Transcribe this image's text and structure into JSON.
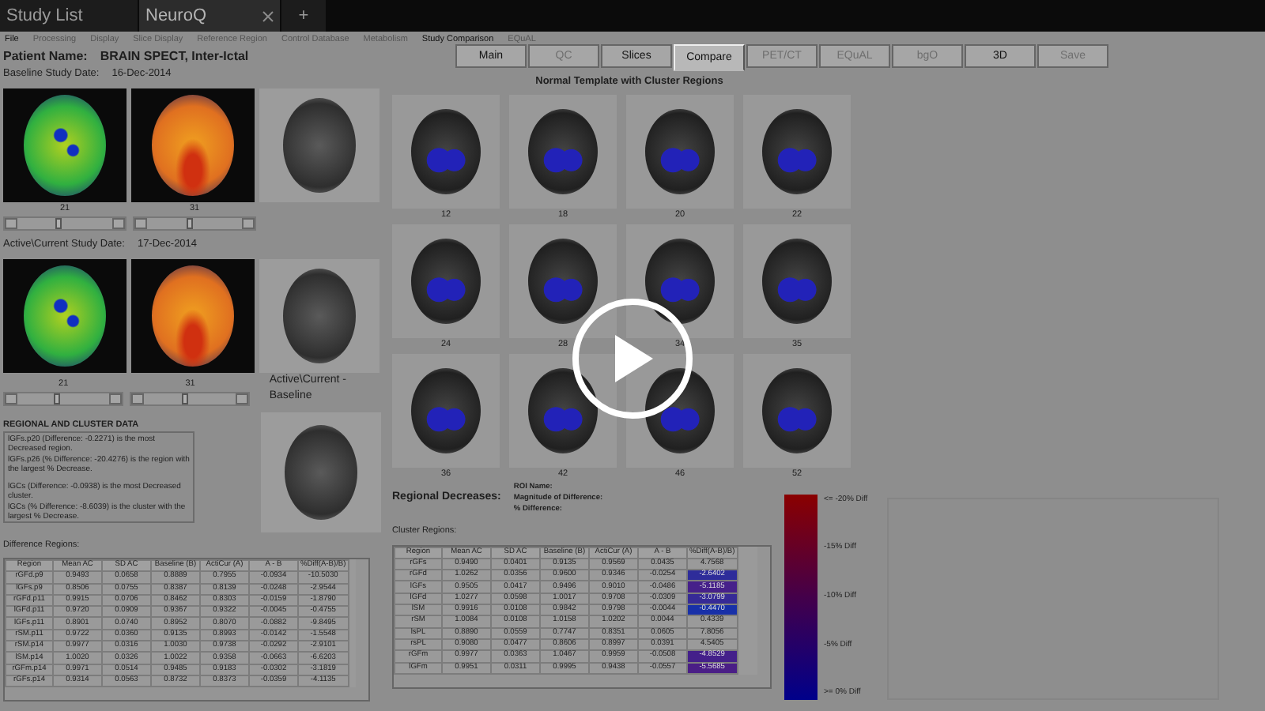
{
  "tabs": [
    {
      "label": "Study List",
      "selected": false,
      "closable": false
    },
    {
      "label": "NeuroQ",
      "selected": true,
      "closable": true
    }
  ],
  "new_tab": "+",
  "menu": [
    {
      "label": "File",
      "disabled": false
    },
    {
      "label": "Processing",
      "disabled": true
    },
    {
      "label": "Display",
      "disabled": true
    },
    {
      "label": "Slice Display",
      "disabled": true
    },
    {
      "label": "Reference Region",
      "disabled": true
    },
    {
      "label": "Control Database",
      "disabled": true
    },
    {
      "label": "Metabolism",
      "disabled": true
    },
    {
      "label": "Study Comparison",
      "disabled": false
    },
    {
      "label": "EQuAL",
      "disabled": true
    }
  ],
  "patient": {
    "name_label": "Patient Name:",
    "name": "BRAIN SPECT, Inter-Ictal",
    "baseline_label": "Baseline Study Date:",
    "baseline_date": "16-Dec-2014"
  },
  "baseline_sliders": [
    {
      "reading": "21",
      "level": 0.46
    },
    {
      "reading": "31",
      "level": 0.47
    }
  ],
  "current": {
    "label": "Active\\Current Study Date:",
    "date": "17-Dec-2014"
  },
  "current_sliders": [
    {
      "reading": "21",
      "level": 0.46
    },
    {
      "reading": "31",
      "level": 0.47
    }
  ],
  "difference_label": "Active\\Current - Baseline",
  "regional": {
    "title": "REGIONAL AND CLUSTER DATA",
    "lines": [
      "lGFs.p20 (Difference:  -0.2271) is the most Decreased region.",
      "lGFs.p26 (% Difference:  -20.4276) is the region with the largest % Decrease.",
      "lGCs (Difference:  -0.0938) is the most Decreased cluster.",
      "lGCs (% Difference:  -8.6039) is the cluster with the largest % Decrease."
    ]
  },
  "difference_table": {
    "title": "Difference Regions:",
    "columns": [
      "Region",
      "Mean AC",
      "SD AC",
      "Baseline (B)",
      "ActiCur (A)",
      "A - B",
      "%Diff(A-B)/B)"
    ],
    "rows": [
      [
        "rGFd.p9",
        "0.9493",
        "0.0658",
        "0.8889",
        "0.7955",
        "-0.0934",
        "-10.5030"
      ],
      [
        "lGFs.p9",
        "0.8506",
        "0.0755",
        "0.8387",
        "0.8139",
        "-0.0248",
        "-2.9544"
      ],
      [
        "rGFd.p11",
        "0.9915",
        "0.0706",
        "0.8462",
        "0.8303",
        "-0.0159",
        "-1.8790"
      ],
      [
        "lGFd.p11",
        "0.9720",
        "0.0909",
        "0.9367",
        "0.9322",
        "-0.0045",
        "-0.4755"
      ],
      [
        "lGFs.p11",
        "0.8901",
        "0.0740",
        "0.8952",
        "0.8070",
        "-0.0882",
        "-9.8495"
      ],
      [
        "rSM.p11",
        "0.9722",
        "0.0360",
        "0.9135",
        "0.8993",
        "-0.0142",
        "-1.5548"
      ],
      [
        "rSM.p14",
        "0.9977",
        "0.0316",
        "1.0030",
        "0.9738",
        "-0.0292",
        "-2.9101"
      ],
      [
        "lSM.p14",
        "1.0020",
        "0.0326",
        "1.0022",
        "0.9358",
        "-0.0663",
        "-6.6203"
      ],
      [
        "rGFm.p14",
        "0.9971",
        "0.0514",
        "0.9485",
        "0.9183",
        "-0.0302",
        "-3.1819"
      ],
      [
        "rGFs.p14",
        "0.9314",
        "0.0563",
        "0.8732",
        "0.8373",
        "-0.0359",
        "-4.1135"
      ]
    ]
  },
  "view_buttons": [
    {
      "label": "Main",
      "disabled": false,
      "selected": false
    },
    {
      "label": "QC",
      "disabled": true,
      "selected": false
    },
    {
      "label": "Slices",
      "disabled": false,
      "selected": false
    },
    {
      "label": "Compare",
      "disabled": false,
      "selected": true
    },
    {
      "label": "PET/CT",
      "disabled": true,
      "selected": false
    },
    {
      "label": "EQuAL",
      "disabled": true,
      "selected": false
    },
    {
      "label": "bgO",
      "disabled": true,
      "selected": false
    },
    {
      "label": "3D",
      "disabled": false,
      "selected": false
    },
    {
      "label": "Save",
      "disabled": true,
      "selected": false
    }
  ],
  "template": {
    "title": "Normal Template with Cluster Regions",
    "slices": [
      "12",
      "18",
      "20",
      "22",
      "24",
      "28",
      "34",
      "35",
      "36",
      "42",
      "46",
      "52"
    ]
  },
  "regional_decreases": {
    "title": "Regional Decreases:",
    "fields": [
      "ROI Name:",
      "Magnitude of Difference:",
      "% Difference:"
    ]
  },
  "cluster_table": {
    "title": "Cluster Regions:",
    "columns": [
      "Region",
      "Mean AC",
      "SD AC",
      "Baseline (B)",
      "ActiCur (A)",
      "A - B",
      "%Diff(A-B)/B)"
    ],
    "rows": [
      {
        "cells": [
          "rGFs",
          "0.9490",
          "0.0401",
          "0.9135",
          "0.9569",
          "0.0435",
          "4.7568"
        ]
      },
      {
        "cells": [
          "rGFd",
          "1.0262",
          "0.0356",
          "0.9600",
          "0.9346",
          "-0.0254",
          "-2.6402"
        ],
        "color": "#2e2c9a"
      },
      {
        "cells": [
          "lGFs",
          "0.9505",
          "0.0417",
          "0.9496",
          "0.9010",
          "-0.0486",
          "-5.1185"
        ],
        "color": "#46208a"
      },
      {
        "cells": [
          "lGFd",
          "1.0277",
          "0.0598",
          "1.0017",
          "0.9708",
          "-0.0309",
          "-3.0799"
        ],
        "color": "#362a96"
      },
      {
        "cells": [
          "lSM",
          "0.9916",
          "0.0108",
          "0.9842",
          "0.9798",
          "-0.0044",
          "-0.4470"
        ],
        "color": "#1830a8"
      },
      {
        "cells": [
          "rSM",
          "1.0084",
          "0.0108",
          "1.0158",
          "1.0202",
          "0.0044",
          "0.4339"
        ]
      },
      {
        "cells": [
          "lsPL",
          "0.8890",
          "0.0559",
          "0.7747",
          "0.8351",
          "0.0605",
          "7.8056"
        ]
      },
      {
        "cells": [
          "rsPL",
          "0.9080",
          "0.0477",
          "0.8606",
          "0.8997",
          "0.0391",
          "4.5405"
        ]
      },
      {
        "cells": [
          "rGFm",
          "0.9977",
          "0.0363",
          "1.0467",
          "0.9959",
          "-0.0508",
          "-4.8529"
        ],
        "color": "#44208a"
      },
      {
        "cells": [
          "lGFm",
          "0.9951",
          "0.0311",
          "0.9995",
          "0.9438",
          "-0.0557",
          "-5.5685"
        ],
        "color": "#4a1e86"
      }
    ]
  },
  "scale": {
    "labels": [
      "<= -20% Diff",
      "-15% Diff",
      "-10% Diff",
      "-5% Diff",
      ">= 0% Diff"
    ]
  }
}
